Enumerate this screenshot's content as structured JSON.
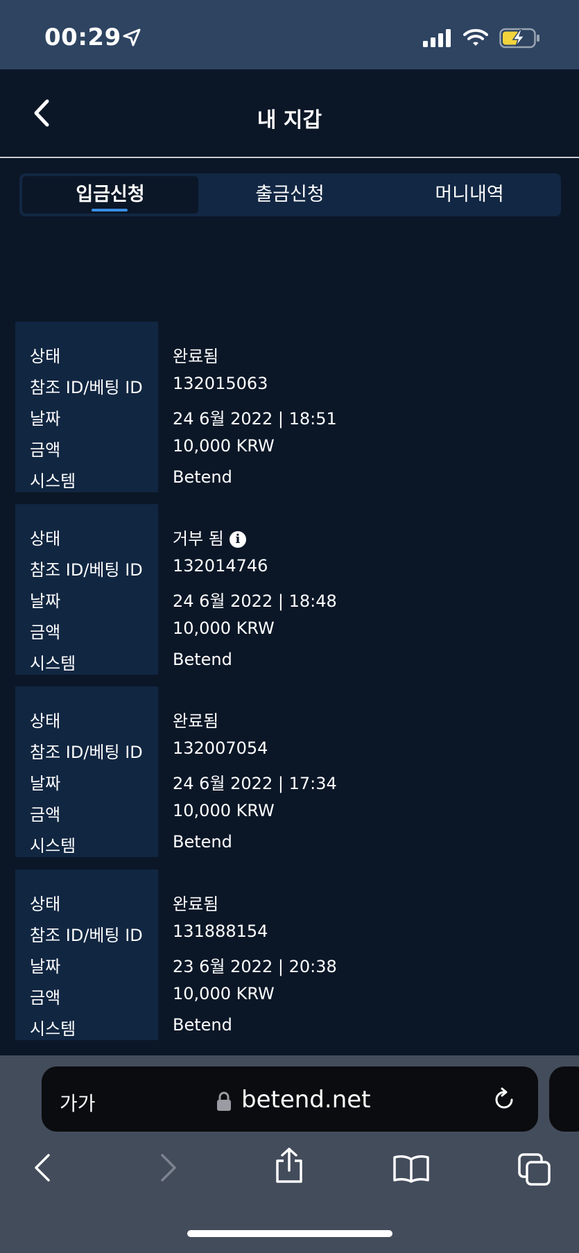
{
  "status_bar": {
    "time": "00:29"
  },
  "header": {
    "title": "내 지갑"
  },
  "tabs": [
    {
      "label": "입금신청",
      "active": true
    },
    {
      "label": "출금신청",
      "active": false
    },
    {
      "label": "머니내역",
      "active": false
    }
  ],
  "labels": {
    "status": "상태",
    "ref_id": "참조 ID/베팅 ID",
    "date": "날짜",
    "amount": "금액",
    "system": "시스템"
  },
  "records": [
    {
      "status": "완료됨",
      "ref_id": "132015063",
      "date": "24 6월 2022 | 18:51",
      "amount": "10,000 KRW",
      "system": "Betend",
      "info_icon": false
    },
    {
      "status": "거부 됨",
      "ref_id": "132014746",
      "date": "24 6월 2022 | 18:48",
      "amount": "10,000 KRW",
      "system": "Betend",
      "info_icon": true
    },
    {
      "status": "완료됨",
      "ref_id": "132007054",
      "date": "24 6월 2022 | 17:34",
      "amount": "10,000 KRW",
      "system": "Betend",
      "info_icon": false
    },
    {
      "status": "완료됨",
      "ref_id": "131888154",
      "date": "23 6월 2022 | 20:38",
      "amount": "10,000 KRW",
      "system": "Betend",
      "info_icon": false
    }
  ],
  "browser": {
    "text_size_label": "가가",
    "url": "betend.net"
  },
  "colors": {
    "background": "#0b1727",
    "card_label_bg": "#112641",
    "status_bar": "#2e4461",
    "tab_underline": "#3a8ee6",
    "browser_bar": "#434c5b"
  }
}
